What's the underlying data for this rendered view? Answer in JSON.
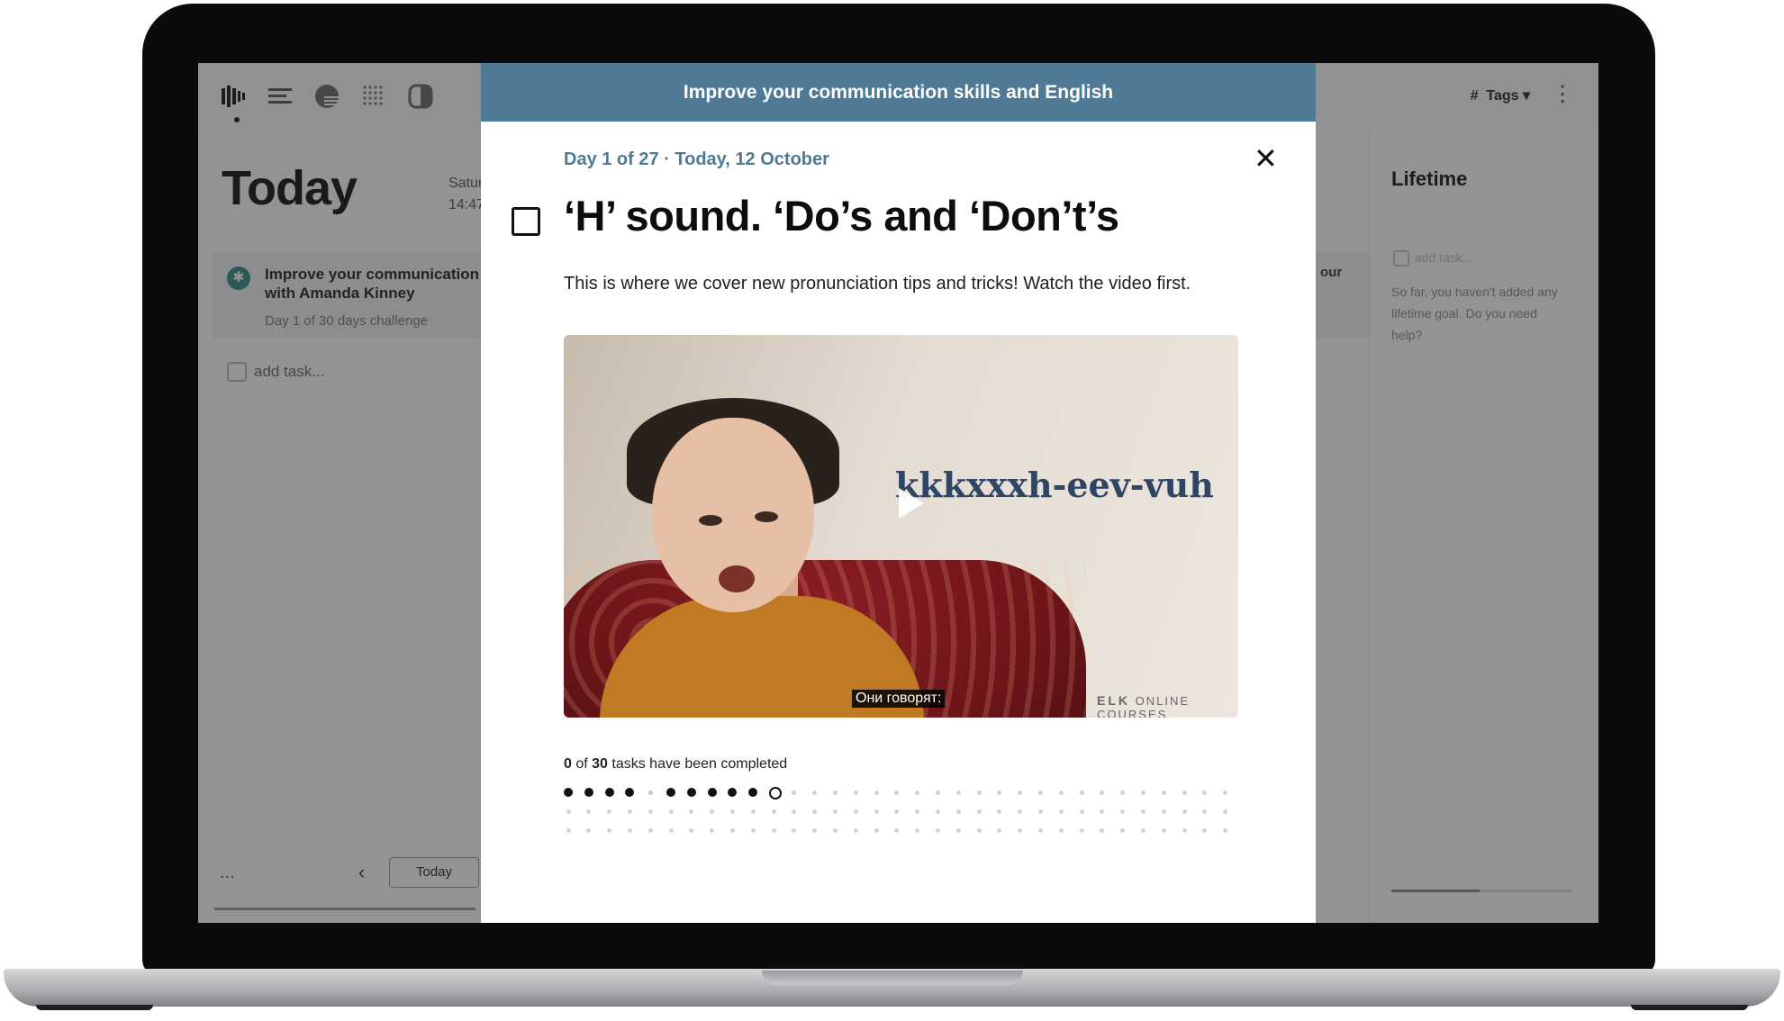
{
  "app": {
    "tags_label": "Tags",
    "title": "Today",
    "date_line1": "Satur",
    "date_line2": "14:47",
    "challenge": {
      "title": "Improve your communication with Amanda Kinney",
      "subtitle": "Day 1 of 30 days challenge",
      "right_clip": "our"
    },
    "add_task": "add task...",
    "ellipsis": "...",
    "prev_arrow": "‹",
    "today_button": "Today",
    "sidebar": {
      "title": "Lifetime",
      "add_task": "add task...",
      "help_text": "So far, you haven't added any lifetime goal. Do you need help?"
    },
    "icons": [
      "sound-wave-icon",
      "list-icon",
      "half-moon-icon",
      "grid-icon",
      "contrast-icon",
      "more-vertical-icon"
    ]
  },
  "modal": {
    "header": "Improve your communication skills and English",
    "day_line": "Day 1 of 27  ·  Today, 12 October",
    "close_symbol": "✕",
    "title": "‘H’ sound. ‘Do’s and ‘Don’t’s",
    "description": "This is where we cover new pronunciation tips and tricks! Watch the video first.",
    "video": {
      "phonetic_text": "kkkxxxh-eev-vuh",
      "subtitle_text": "Они говорят:",
      "brand_main": "ELK",
      "brand_sub": "ONLINE COURSES"
    },
    "progress": {
      "completed": "0",
      "total": "30",
      "text": "tasks have been completed",
      "dots_row1": [
        "filled",
        "filled",
        "filled",
        "filled",
        "light",
        "filled",
        "filled",
        "filled",
        "filled",
        "filled",
        "current",
        "empty",
        "empty",
        "empty",
        "empty",
        "empty",
        "empty",
        "empty",
        "empty",
        "empty",
        "empty",
        "empty",
        "empty",
        "empty",
        "empty",
        "empty",
        "empty",
        "empty",
        "empty",
        "empty",
        "empty",
        "empty",
        "empty"
      ],
      "dots_rows_extra": 2,
      "dots_per_row": 33
    }
  },
  "colors": {
    "accent": "#4f7a96",
    "challenge_icon": "#2f8a86"
  }
}
